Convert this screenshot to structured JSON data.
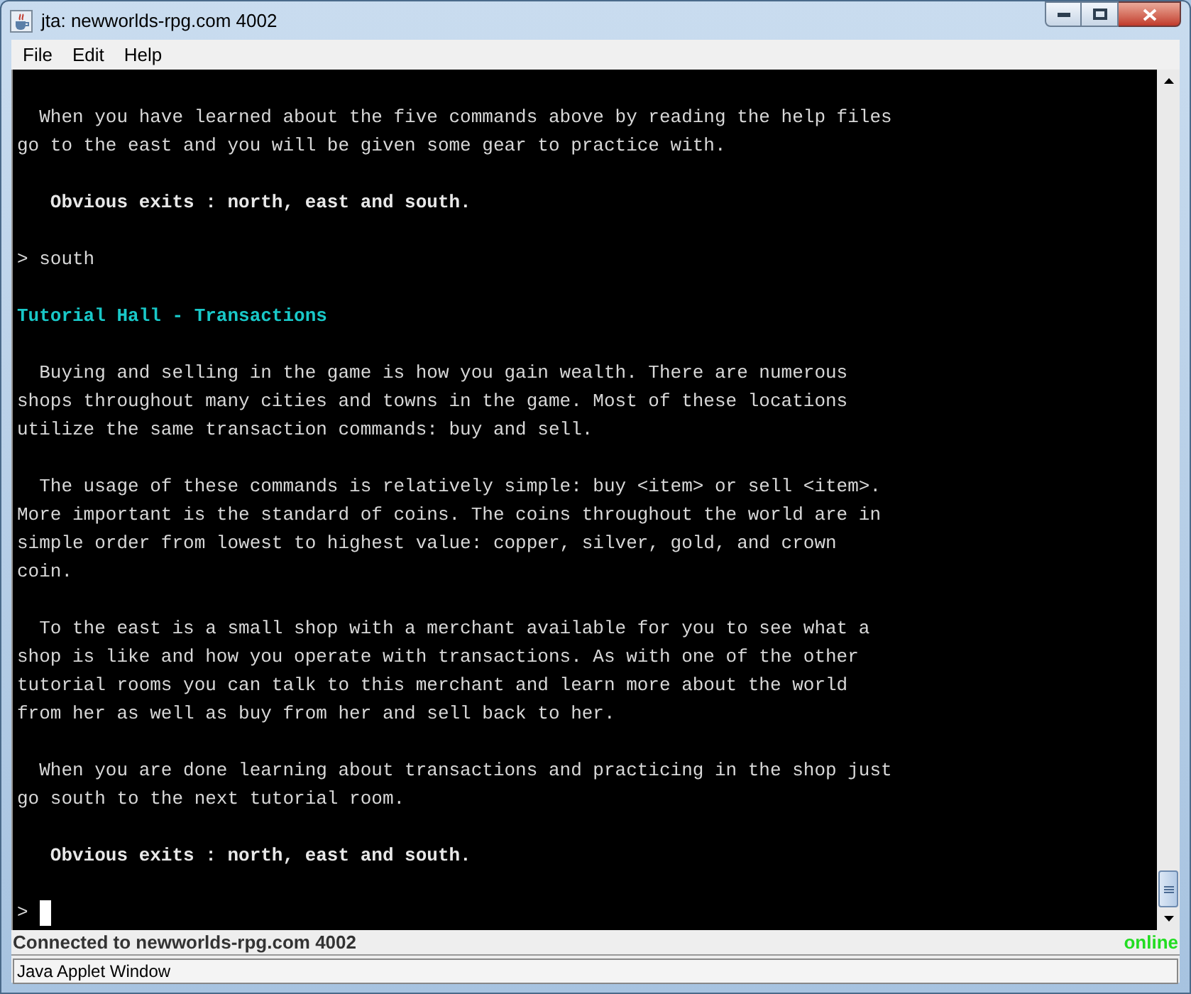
{
  "window": {
    "title": "jta: newworlds-rpg.com 4002"
  },
  "menu": [
    "File",
    "Edit",
    "Help"
  ],
  "terminal": {
    "lines": [
      {
        "kind": "blank"
      },
      {
        "kind": "text",
        "text": "  When you have learned about the five commands above by reading the help files"
      },
      {
        "kind": "text",
        "text": "go to the east and you will be given some gear to practice with."
      },
      {
        "kind": "blank"
      },
      {
        "kind": "bold",
        "text": "   Obvious exits : north, east and south."
      },
      {
        "kind": "blank"
      },
      {
        "kind": "text",
        "text": "> south"
      },
      {
        "kind": "blank"
      },
      {
        "kind": "heading",
        "text": "Tutorial Hall - Transactions"
      },
      {
        "kind": "blank"
      },
      {
        "kind": "text",
        "text": "  Buying and selling in the game is how you gain wealth. There are numerous"
      },
      {
        "kind": "text",
        "text": "shops throughout many cities and towns in the game. Most of these locations"
      },
      {
        "kind": "text",
        "text": "utilize the same transaction commands: buy and sell."
      },
      {
        "kind": "blank"
      },
      {
        "kind": "text",
        "text": "  The usage of these commands is relatively simple: buy <item> or sell <item>."
      },
      {
        "kind": "text",
        "text": "More important is the standard of coins. The coins throughout the world are in"
      },
      {
        "kind": "text",
        "text": "simple order from lowest to highest value: copper, silver, gold, and crown"
      },
      {
        "kind": "text",
        "text": "coin."
      },
      {
        "kind": "blank"
      },
      {
        "kind": "text",
        "text": "  To the east is a small shop with a merchant available for you to see what a"
      },
      {
        "kind": "text",
        "text": "shop is like and how you operate with transactions. As with one of the other"
      },
      {
        "kind": "text",
        "text": "tutorial rooms you can talk to this merchant and learn more about the world"
      },
      {
        "kind": "text",
        "text": "from her as well as buy from her and sell back to her."
      },
      {
        "kind": "blank"
      },
      {
        "kind": "text",
        "text": "  When you are done learning about transactions and practicing in the shop just"
      },
      {
        "kind": "text",
        "text": "go south to the next tutorial room."
      },
      {
        "kind": "blank"
      },
      {
        "kind": "bold",
        "text": "   Obvious exits : north, east and south."
      },
      {
        "kind": "blank"
      },
      {
        "kind": "prompt",
        "text": ">"
      }
    ]
  },
  "status_bar": {
    "text": "Connected to newworlds-rpg.com 4002",
    "state": "online"
  },
  "applet_bar": "Java Applet Window"
}
